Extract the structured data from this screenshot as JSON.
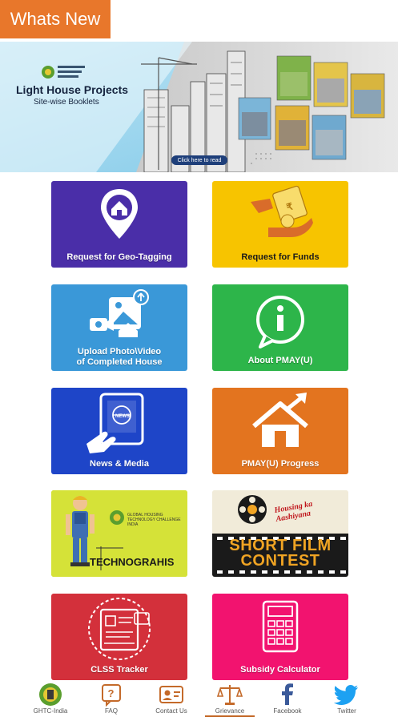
{
  "header": {
    "whats_new": "Whats New"
  },
  "banner": {
    "title": "Light House Projects",
    "subtitle": "Site-wise Booklets",
    "cta": "Click here to read"
  },
  "tiles": [
    {
      "label": "Request for Geo-Tagging",
      "color": "#4a2ea8",
      "icon": "location-pin-house-icon"
    },
    {
      "label": "Request for Funds",
      "color": "#f7c400",
      "icon": "money-hand-icon"
    },
    {
      "label": "Upload Photo\\Video\nof Completed House",
      "color": "#3a98d8",
      "icon": "upload-media-icon"
    },
    {
      "label": "About PMAY(U)",
      "color": "#2db54a",
      "icon": "info-bubble-icon"
    },
    {
      "label": "News & Media",
      "color": "#1e45c8",
      "icon": "tablet-news-icon"
    },
    {
      "label": "PMAY(U) Progress",
      "color": "#e3741f",
      "icon": "house-progress-icon"
    },
    {
      "label": "TECHNOGRAHIS",
      "color": "#c7d71e",
      "icon": "technograhis-icon",
      "small_text": "GLOBAL HOUSING TECHNOLOGY CHALLENGE INDIA"
    },
    {
      "label": "SHORT FILM CONTEST",
      "color": "#1a1a1a",
      "icon": "film-reel-icon",
      "tag": "Housing ka Aashiyana"
    },
    {
      "label": "CLSS Tracker",
      "color": "#d3303b",
      "icon": "clss-tracker-icon"
    },
    {
      "label": "Subsidy Calculator",
      "color": "#f2136f",
      "icon": "calculator-icon"
    }
  ],
  "bottom_nav": [
    {
      "label": "GHTC-India",
      "icon": "ghtc-logo-icon"
    },
    {
      "label": "FAQ",
      "icon": "faq-icon"
    },
    {
      "label": "Contact Us",
      "icon": "contact-card-icon"
    },
    {
      "label": "Grievance",
      "icon": "scales-icon"
    },
    {
      "label": "Facebook",
      "icon": "facebook-icon"
    },
    {
      "label": "Twitter",
      "icon": "twitter-icon"
    }
  ]
}
